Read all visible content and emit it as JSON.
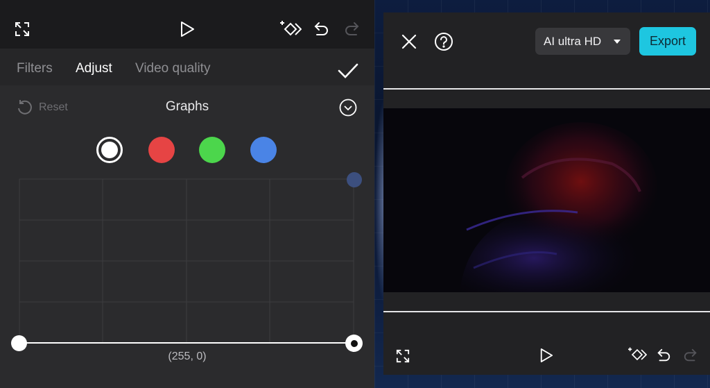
{
  "editor": {
    "tabs": [
      {
        "label": "Filters"
      },
      {
        "label": "Adjust"
      },
      {
        "label": "Video quality"
      }
    ],
    "reset_label": "Reset",
    "section_title": "Graphs",
    "channels": [
      {
        "name": "white",
        "color": "#ffffff",
        "selected": true
      },
      {
        "name": "red",
        "color": "#e64444",
        "selected": false
      },
      {
        "name": "green",
        "color": "#4cd64c",
        "selected": false
      },
      {
        "name": "blue",
        "color": "#4a84e6",
        "selected": false
      }
    ],
    "curve_point_readout": "(255, 0)"
  },
  "export_panel": {
    "quality_option": "AI ultra HD",
    "export_label": "Export"
  },
  "colors": {
    "accent": "#1ec6e0",
    "panel": "#2b2b2d",
    "toolbar": "#1b1b1d"
  }
}
